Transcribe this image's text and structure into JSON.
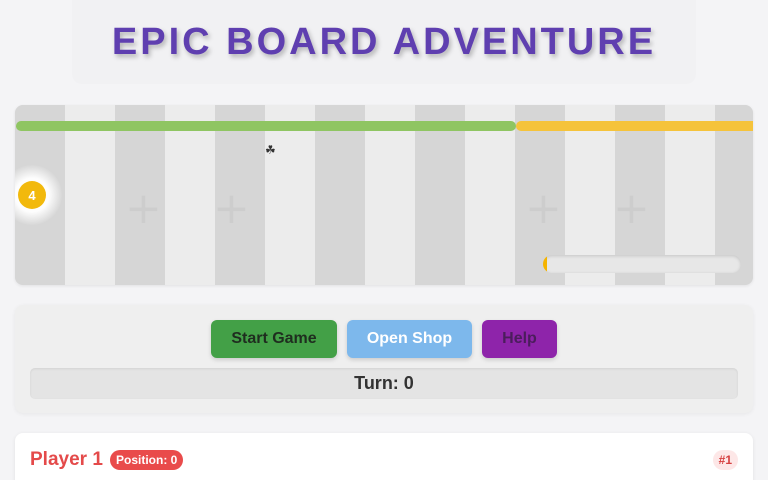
{
  "title": "EPIC BOARD ADVENTURE",
  "board": {
    "token_label": "4",
    "bonus_icon": "clover-icon",
    "bonus_glyph": "☘",
    "progress_fraction": 0.02,
    "colors": {
      "path_green": "#8fc562",
      "path_yellow": "#f5c33b",
      "token": "#f2b90c"
    }
  },
  "controls": {
    "start_label": "Start Game",
    "shop_label": "Open Shop",
    "help_label": "Help",
    "turn_text": "Turn: 0"
  },
  "player": {
    "name": "Player 1",
    "position_text": "Position: 0",
    "rank_text": "#1",
    "color": "#e44a4a"
  }
}
